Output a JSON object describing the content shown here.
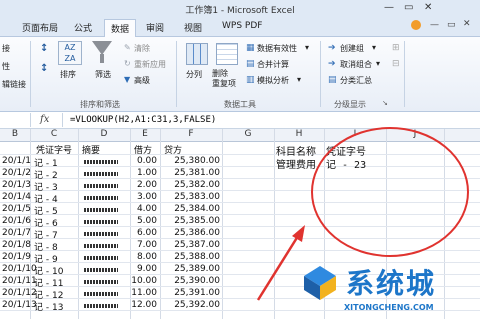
{
  "window": {
    "title": "工作簿1 - Microsoft Excel"
  },
  "tabs": [
    "页面布局",
    "公式",
    "数据",
    "审阅",
    "视图",
    "WPS PDF"
  ],
  "ribbon": {
    "sort_filter": {
      "sort_label": "排序",
      "filter_label": "筛选",
      "clear_label": "清除",
      "reapply_label": "重新应用",
      "advanced_label": "高级",
      "group_label": "排序和筛选",
      "left_clip_1": "接",
      "left_clip_2": "性",
      "left_clip_3": "辑链接"
    },
    "data_tools": {
      "split_label": "分列",
      "remove_dup_label": "删除\n重复项",
      "validation_label": "数据有效性",
      "consolidate_label": "合并计算",
      "whatif_label": "模拟分析",
      "group_label": "数据工具"
    },
    "outline": {
      "create_group_label": "创建组",
      "ungroup_label": "取消组合",
      "subtotal_label": "分类汇总",
      "group_label": "分级显示"
    }
  },
  "formula_bar": {
    "fx": "fx",
    "formula": "=VLOOKUP(H2,A1:C31,3,FALSE)"
  },
  "columns": [
    "B",
    "C",
    "D",
    "E",
    "F",
    "G",
    "H",
    "I",
    "J"
  ],
  "table": {
    "headers": {
      "c": "凭证字号",
      "d": "摘要",
      "e": "借方",
      "f": "贷方"
    },
    "rows": [
      {
        "b": "20/1/1",
        "c": "记 - 1",
        "e": "0.00",
        "f": "25,380.00"
      },
      {
        "b": "20/1/2",
        "c": "记 - 2",
        "e": "1.00",
        "f": "25,381.00"
      },
      {
        "b": "20/1/3",
        "c": "记 - 3",
        "e": "2.00",
        "f": "25,382.00"
      },
      {
        "b": "20/1/4",
        "c": "记 - 4",
        "e": "3.00",
        "f": "25,383.00"
      },
      {
        "b": "20/1/5",
        "c": "记 - 5",
        "e": "4.00",
        "f": "25,384.00"
      },
      {
        "b": "20/1/6",
        "c": "记 - 6",
        "e": "5.00",
        "f": "25,385.00"
      },
      {
        "b": "20/1/7",
        "c": "记 - 7",
        "e": "6.00",
        "f": "25,386.00"
      },
      {
        "b": "20/1/8",
        "c": "记 - 8",
        "e": "7.00",
        "f": "25,387.00"
      },
      {
        "b": "20/1/9",
        "c": "记 - 9",
        "e": "8.00",
        "f": "25,388.00"
      },
      {
        "b": "20/1/10",
        "c": "记 - 10",
        "e": "9.00",
        "f": "25,389.00"
      },
      {
        "b": "20/1/11",
        "c": "记 - 11",
        "e": "10.00",
        "f": "25,390.00"
      },
      {
        "b": "20/1/12",
        "c": "记 - 12",
        "e": "11.00",
        "f": "25,391.00"
      },
      {
        "b": "20/1/13",
        "c": "记 - 13",
        "e": "12.00",
        "f": "25,392.00"
      }
    ]
  },
  "lookup": {
    "h_header": "科目名称",
    "i_header": "凭证字号",
    "h_value": "管理费用",
    "i_value": "记 - 23"
  },
  "watermark": {
    "brand": "系统城",
    "domain": "XITONGCHENG.COM"
  },
  "colors": {
    "annotation_red": "#e0332f",
    "ribbon_blue": "#dfe9f5",
    "watermark_blue": "#1d76c9"
  }
}
